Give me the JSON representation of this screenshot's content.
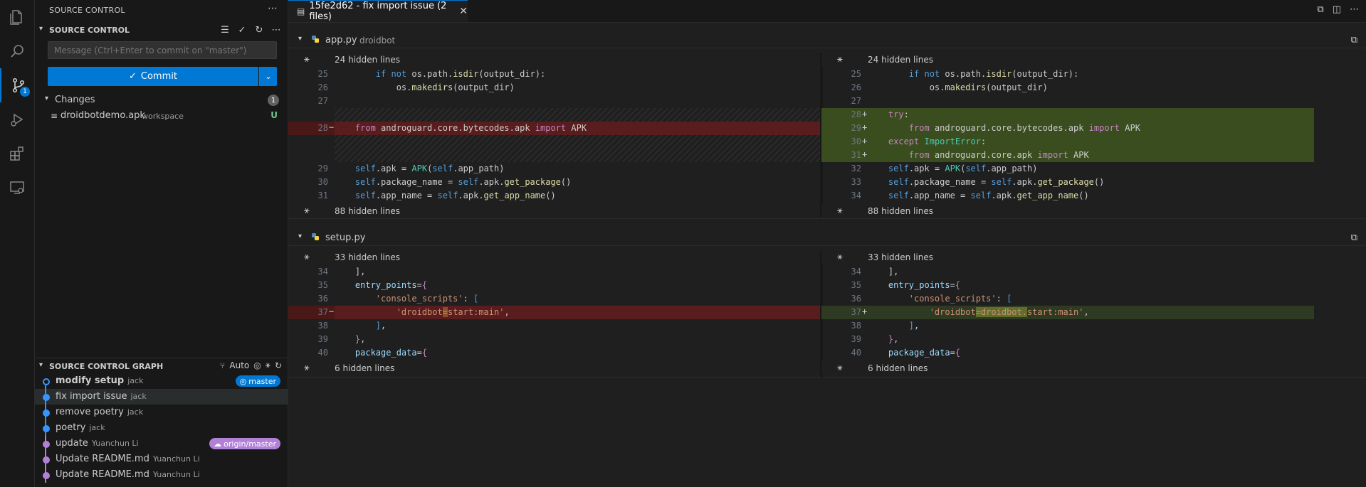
{
  "activity": {
    "items": [
      "explorer-icon",
      "search-icon",
      "source-control-icon",
      "run-debug-icon",
      "extensions-icon",
      "remote-explorer-icon"
    ],
    "scm_badge": "1"
  },
  "sidebar": {
    "title": "SOURCE CONTROL",
    "scm_section": "SOURCE CONTROL",
    "message_placeholder": "Message (Ctrl+Enter to commit on \"master\")",
    "commit_label": "Commit",
    "changes_label": "Changes",
    "changes_count": "1",
    "changed_file": {
      "name": "droidbotdemo.apk",
      "desc": "workspace",
      "status": "U"
    },
    "graph": {
      "title": "SOURCE CONTROL GRAPH",
      "auto_label": "Auto",
      "commits": [
        {
          "message": "modify setup",
          "author": "jack",
          "badge": "master",
          "badge_color": "#0078d4"
        },
        {
          "message": "fix import issue",
          "author": "jack",
          "badge": "",
          "badge_color": ""
        },
        {
          "message": "remove poetry",
          "author": "jack",
          "badge": "",
          "badge_color": ""
        },
        {
          "message": "poetry",
          "author": "jack",
          "badge": "",
          "badge_color": ""
        },
        {
          "message": "update",
          "author": "Yuanchun Li",
          "badge": "origin/master",
          "badge_color": "#b180d7"
        },
        {
          "message": "Update README.md",
          "author": "Yuanchun Li",
          "badge": "",
          "badge_color": ""
        },
        {
          "message": "Update README.md",
          "author": "Yuanchun Li",
          "badge": "",
          "badge_color": ""
        }
      ]
    }
  },
  "editor": {
    "tab_label": "15fe2d62 - fix import issue (2 files)",
    "files": [
      {
        "name": "app.py",
        "desc": "droidbot",
        "hidden_top": "24 hidden lines",
        "hidden_bottom": "88 hidden lines"
      },
      {
        "name": "setup.py",
        "desc": "",
        "hidden_top": "33 hidden lines",
        "hidden_bottom": "6 hidden lines"
      }
    ]
  }
}
